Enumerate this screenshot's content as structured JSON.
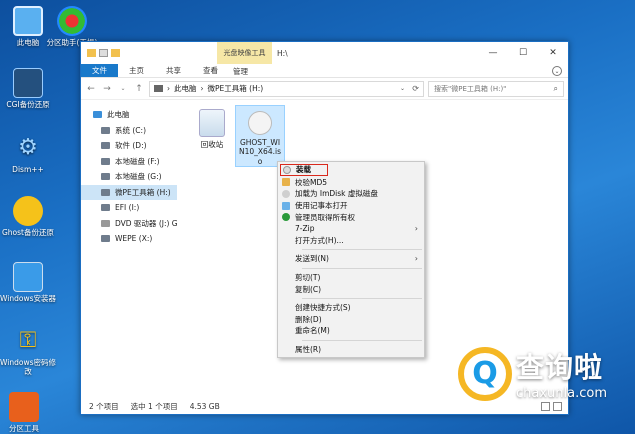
{
  "desktop": {
    "icons": [
      {
        "label": "此电脑",
        "icon": "computer-icon"
      },
      {
        "label": "分区助手(无损)",
        "icon": "partition-assistant-icon"
      },
      {
        "label": "CGI备份还原",
        "icon": "cgi-backup-icon"
      },
      {
        "label": "Dism++",
        "icon": "gear-icon"
      },
      {
        "label": "Ghost备份还原",
        "icon": "ghost-icon"
      },
      {
        "label": "Windows安装器",
        "icon": "windows-installer-icon"
      },
      {
        "label": "Windows密码修改",
        "icon": "key-icon"
      },
      {
        "label": "分区工具",
        "icon": "partition-tool-icon"
      }
    ]
  },
  "window": {
    "context_tab": "光盘映像工具",
    "title": "H:\\",
    "controls": {
      "minimize": "—",
      "maximize": "☐",
      "close": "✕"
    },
    "ribbon": {
      "file": "文件",
      "home": "主页",
      "share": "共享",
      "view": "查看",
      "manage": "管理",
      "expand": "⌄"
    },
    "address": {
      "back": "←",
      "forward": "→",
      "dropdown": "⌄",
      "up": "↑",
      "path_root": "此电脑",
      "sep": "›",
      "path_current": "微PE工具箱 (H:)",
      "refresh": "⟳"
    },
    "search": {
      "placeholder": "搜索\"微PE工具箱 (H:)\"",
      "icon": "⌕"
    },
    "sidebar": [
      {
        "label": "此电脑"
      },
      {
        "label": "系统 (C:)"
      },
      {
        "label": "软件 (D:)"
      },
      {
        "label": "本地磁盘 (F:)"
      },
      {
        "label": "本地磁盘 (G:)"
      },
      {
        "label": "微PE工具箱 (H:)"
      },
      {
        "label": "EFI (I:)"
      },
      {
        "label": "DVD 驱动器 (J:) GH"
      },
      {
        "label": "WEPE (X:)"
      }
    ],
    "files": [
      {
        "label": "回收站"
      },
      {
        "label": "GHOST_WIN10_X64.iso"
      }
    ],
    "status": {
      "count": "2 个项目",
      "selected": "选中 1 个项目",
      "size": "4.53 GB"
    }
  },
  "context_menu": {
    "groups": [
      [
        {
          "label": "装载",
          "icon": "disc-icon"
        },
        {
          "label": "校验MD5",
          "icon": "md5-icon"
        },
        {
          "label": "加载为 ImDisk 虚拟磁盘",
          "icon": "imdisk-icon"
        },
        {
          "label": "使用记事本打开",
          "icon": "notepad-icon"
        },
        {
          "label": "管理员取得所有权",
          "icon": "shield-icon"
        },
        {
          "label": "7-Zip",
          "icon": "",
          "arrow": "›"
        },
        {
          "label": "打开方式(H)...",
          "icon": ""
        }
      ],
      [
        {
          "label": "发送到(N)",
          "icon": "",
          "arrow": "›"
        }
      ],
      [
        {
          "label": "剪切(T)",
          "icon": ""
        },
        {
          "label": "复制(C)",
          "icon": ""
        }
      ],
      [
        {
          "label": "创建快捷方式(S)",
          "icon": ""
        },
        {
          "label": "删除(D)",
          "icon": ""
        },
        {
          "label": "重命名(M)",
          "icon": ""
        }
      ],
      [
        {
          "label": "属性(R)",
          "icon": ""
        }
      ]
    ]
  },
  "watermark": {
    "letter": "Q",
    "name": "查询啦",
    "url": "chaxunla.com"
  },
  "colors": {
    "accent": "#1979ca",
    "highlight_border": "#d9291c",
    "context_tab_bg": "#f6e7a6",
    "watermark_ring": "#f5b724"
  }
}
